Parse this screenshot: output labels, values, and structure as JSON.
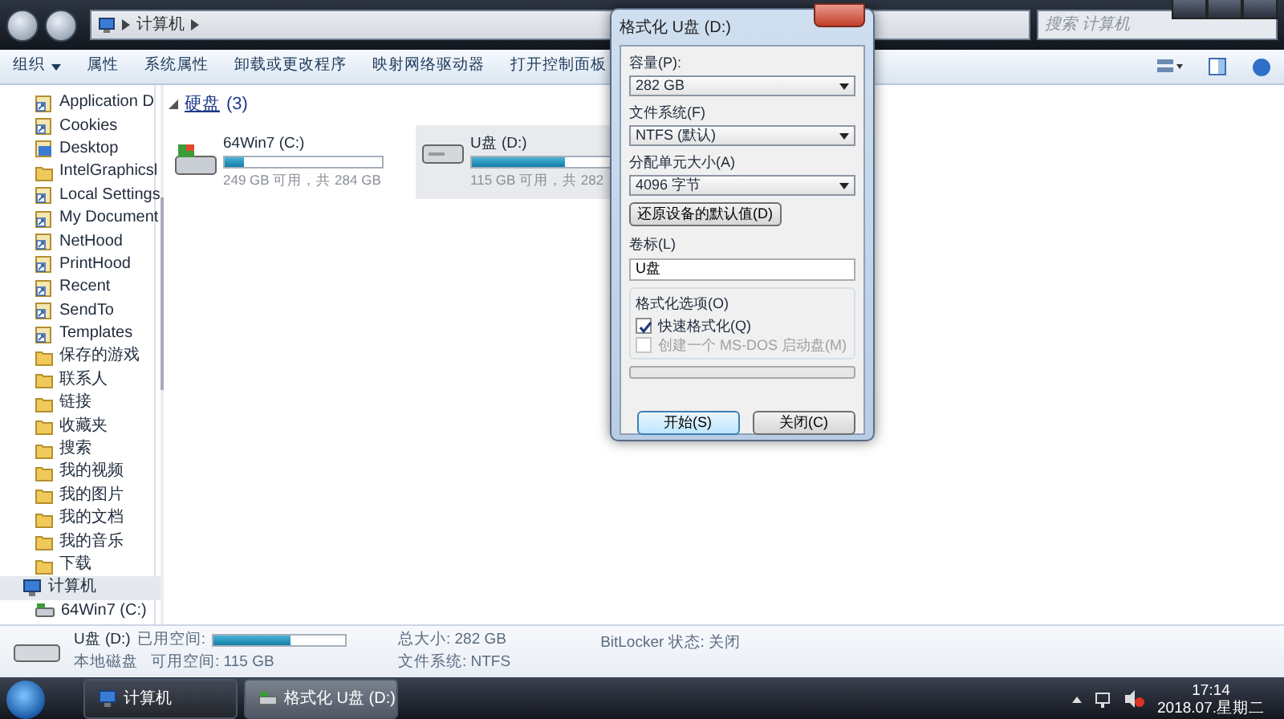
{
  "window": {
    "address": {
      "crumbs": [
        "计算机"
      ]
    },
    "search": {
      "placeholder": "搜索 计算机"
    }
  },
  "toolbar": {
    "items": [
      {
        "label": "组织",
        "dropdown": true
      },
      {
        "label": "属性",
        "dropdown": false
      },
      {
        "label": "系统属性",
        "dropdown": false
      },
      {
        "label": "卸载或更改程序",
        "dropdown": false
      },
      {
        "label": "映射网络驱动器",
        "dropdown": false
      },
      {
        "label": "打开控制面板",
        "dropdown": false
      }
    ]
  },
  "sidebar": {
    "items": [
      {
        "label": "Application D",
        "kind": "shortcut",
        "selected": false
      },
      {
        "label": "Cookies",
        "kind": "shortcut",
        "selected": false
      },
      {
        "label": "Desktop",
        "kind": "desktop",
        "selected": false
      },
      {
        "label": "IntelGraphicsl",
        "kind": "folder",
        "selected": false
      },
      {
        "label": "Local Settings",
        "kind": "shortcut",
        "selected": false
      },
      {
        "label": "My Document",
        "kind": "shortcut",
        "selected": false
      },
      {
        "label": "NetHood",
        "kind": "shortcut",
        "selected": false
      },
      {
        "label": "PrintHood",
        "kind": "shortcut",
        "selected": false
      },
      {
        "label": "Recent",
        "kind": "shortcut",
        "selected": false
      },
      {
        "label": "SendTo",
        "kind": "shortcut",
        "selected": false
      },
      {
        "label": "Templates",
        "kind": "shortcut",
        "selected": false
      },
      {
        "label": "保存的游戏",
        "kind": "folder",
        "selected": false
      },
      {
        "label": "联系人",
        "kind": "folder",
        "selected": false
      },
      {
        "label": "链接",
        "kind": "folder",
        "selected": false
      },
      {
        "label": "收藏夹",
        "kind": "folder",
        "selected": false
      },
      {
        "label": "搜索",
        "kind": "folder",
        "selected": false
      },
      {
        "label": "我的视频",
        "kind": "folder",
        "selected": false
      },
      {
        "label": "我的图片",
        "kind": "folder",
        "selected": false
      },
      {
        "label": "我的文档",
        "kind": "folder",
        "selected": false
      },
      {
        "label": "我的音乐",
        "kind": "folder",
        "selected": false
      },
      {
        "label": "下载",
        "kind": "folder",
        "selected": false
      },
      {
        "label": "计算机",
        "kind": "computer",
        "selected": true,
        "children": [
          {
            "label": "64Win7 (C:)",
            "kind": "drive",
            "selected": false
          }
        ]
      }
    ]
  },
  "content": {
    "group": {
      "title": "硬盘",
      "count": "(3)",
      "expanded": true
    },
    "drives": [
      {
        "name": "64Win7 (C:)",
        "kind": "system",
        "level": 0.12,
        "info": "249 GB 可用，共 284 GB",
        "selected": false
      },
      {
        "name": "U盘 (D:)",
        "kind": "removable",
        "level": 0.59,
        "info": "115 GB 可用，共 282",
        "selected": true
      }
    ]
  },
  "dialog": {
    "title": "格式化 U盘 (D:)",
    "fields": [
      {
        "label": "容量(P):",
        "value": "282 GB"
      },
      {
        "label": "文件系统(F)",
        "value": "NTFS (默认)"
      },
      {
        "label": "分配单元大小(A)",
        "value": "4096 字节"
      }
    ],
    "restore_button": "还原设备的默认值(D)",
    "volume_label": {
      "label": "卷标(L)",
      "value": "U盘"
    },
    "options": {
      "title": "格式化选项(O)",
      "items": [
        {
          "label": "快速格式化(Q)",
          "checked": true,
          "disabled": false
        },
        {
          "label": "创建一个 MS-DOS 启动盘(M)",
          "checked": false,
          "disabled": true
        }
      ]
    },
    "progress": {
      "level": 0
    },
    "buttons": [
      {
        "label": "开始(S)",
        "default": true
      },
      {
        "label": "关闭(C)",
        "default": false
      }
    ]
  },
  "details": {
    "name": "U盘 (D:)",
    "type": "本地磁盘",
    "used_label": "已用空间:",
    "level": 0.59,
    "free": "可用空间: 115 GB",
    "total": "总大小: 282 GB",
    "filesystem": "文件系统: NTFS",
    "bitlocker": "BitLocker 状态: 关闭"
  },
  "taskbar": {
    "buttons": [
      {
        "label": "计算机",
        "kind": "computer",
        "selected": false
      },
      {
        "label": "格式化 U盘 (D:)",
        "kind": "drive",
        "selected": true
      }
    ],
    "clock": {
      "time": "17:14",
      "date": "2018.07.星期二"
    }
  }
}
